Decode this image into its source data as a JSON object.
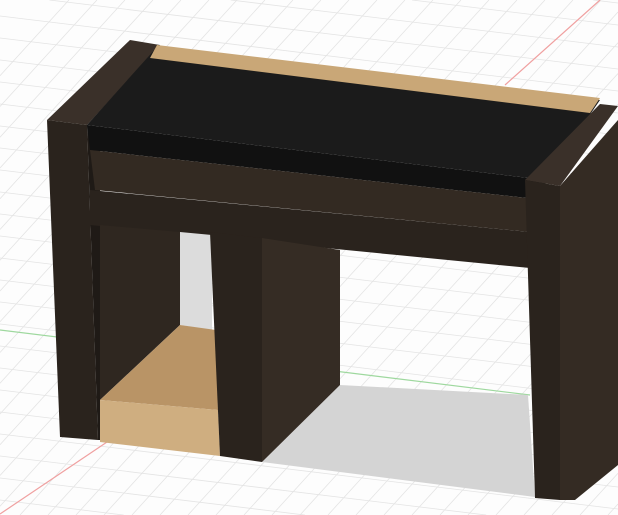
{
  "viewport": {
    "model": "desk",
    "colors": {
      "background": "#fdfdfd",
      "grid": "#e4e4e4",
      "x_axis": "#f0a0a0",
      "y_axis": "#9ed89e",
      "dark_wood": "#2a231d",
      "black_top": "#151515",
      "light_wood": "#c9a777",
      "shadow": "#d2d2d2"
    }
  }
}
